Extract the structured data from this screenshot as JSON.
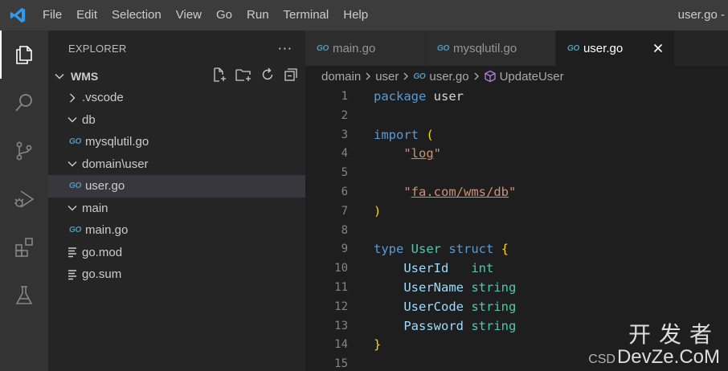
{
  "titlebar": {
    "menu": [
      "File",
      "Edit",
      "Selection",
      "View",
      "Go",
      "Run",
      "Terminal",
      "Help"
    ],
    "title": "user.go -"
  },
  "activitybar": {
    "items": [
      "explorer-icon",
      "search-icon",
      "source-control-icon",
      "run-debug-icon",
      "extensions-icon",
      "testing-icon"
    ]
  },
  "sidebar": {
    "title": "EXPLORER",
    "more": "···",
    "workspace": "WMS",
    "tree": [
      {
        "label": ".vscode",
        "kind": "folder",
        "expanded": false,
        "depth": 1
      },
      {
        "label": "db",
        "kind": "folder",
        "expanded": true,
        "depth": 1
      },
      {
        "label": "mysqlutil.go",
        "kind": "go",
        "depth": 2
      },
      {
        "label": "domain\\user",
        "kind": "folder",
        "expanded": true,
        "depth": 1
      },
      {
        "label": "user.go",
        "kind": "go",
        "depth": 2,
        "selected": true
      },
      {
        "label": "main",
        "kind": "folder",
        "expanded": true,
        "depth": 1
      },
      {
        "label": "main.go",
        "kind": "go",
        "depth": 2
      },
      {
        "label": "go.mod",
        "kind": "file",
        "depth": 1
      },
      {
        "label": "go.sum",
        "kind": "file",
        "depth": 1
      }
    ]
  },
  "tabs": [
    {
      "label": "main.go",
      "active": false
    },
    {
      "label": "mysqlutil.go",
      "active": false
    },
    {
      "label": "user.go",
      "active": true
    }
  ],
  "go_badge": "GO",
  "breadcrumbs": {
    "parts": [
      "domain",
      "user",
      "user.go",
      "UpdateUser"
    ]
  },
  "code": {
    "line_numbers": [
      "1",
      "2",
      "3",
      "4",
      "5",
      "6",
      "7",
      "8",
      "9",
      "10",
      "11",
      "12",
      "13",
      "14",
      "15"
    ],
    "lines": [
      [
        {
          "t": "package",
          "c": "kw"
        },
        {
          "t": " user",
          "c": ""
        }
      ],
      [],
      [
        {
          "t": "import",
          "c": "kw"
        },
        {
          "t": " ",
          "c": ""
        },
        {
          "t": "(",
          "c": "br"
        }
      ],
      [
        {
          "t": "    ",
          "c": ""
        },
        {
          "t": "\"",
          "c": "str"
        },
        {
          "t": "log",
          "c": "str uline"
        },
        {
          "t": "\"",
          "c": "str"
        }
      ],
      [],
      [
        {
          "t": "    ",
          "c": ""
        },
        {
          "t": "\"",
          "c": "str"
        },
        {
          "t": "fa.com/wms/db",
          "c": "str uline"
        },
        {
          "t": "\"",
          "c": "str"
        }
      ],
      [
        {
          "t": ")",
          "c": "br"
        }
      ],
      [],
      [
        {
          "t": "type",
          "c": "kw"
        },
        {
          "t": " ",
          "c": ""
        },
        {
          "t": "User",
          "c": "ty"
        },
        {
          "t": " ",
          "c": ""
        },
        {
          "t": "struct",
          "c": "kw"
        },
        {
          "t": " ",
          "c": ""
        },
        {
          "t": "{",
          "c": "br"
        }
      ],
      [
        {
          "t": "    UserId   ",
          "c": "fd"
        },
        {
          "t": "int",
          "c": "ty"
        }
      ],
      [
        {
          "t": "    UserName ",
          "c": "fd"
        },
        {
          "t": "string",
          "c": "ty"
        }
      ],
      [
        {
          "t": "    UserCode ",
          "c": "fd"
        },
        {
          "t": "string",
          "c": "ty"
        }
      ],
      [
        {
          "t": "    Password ",
          "c": "fd"
        },
        {
          "t": "string",
          "c": "ty"
        }
      ],
      [
        {
          "t": "}",
          "c": "br"
        }
      ],
      []
    ]
  },
  "watermark": {
    "cn": "开发者",
    "prefix": "CSD",
    "en": "DevZe.CoM"
  },
  "colors": {
    "keyword": "#569cd6",
    "string": "#ce9178",
    "type": "#4ec9b0",
    "bracket": "#ffd700",
    "field": "#9cdcfe",
    "go_icon": "#519aba"
  }
}
